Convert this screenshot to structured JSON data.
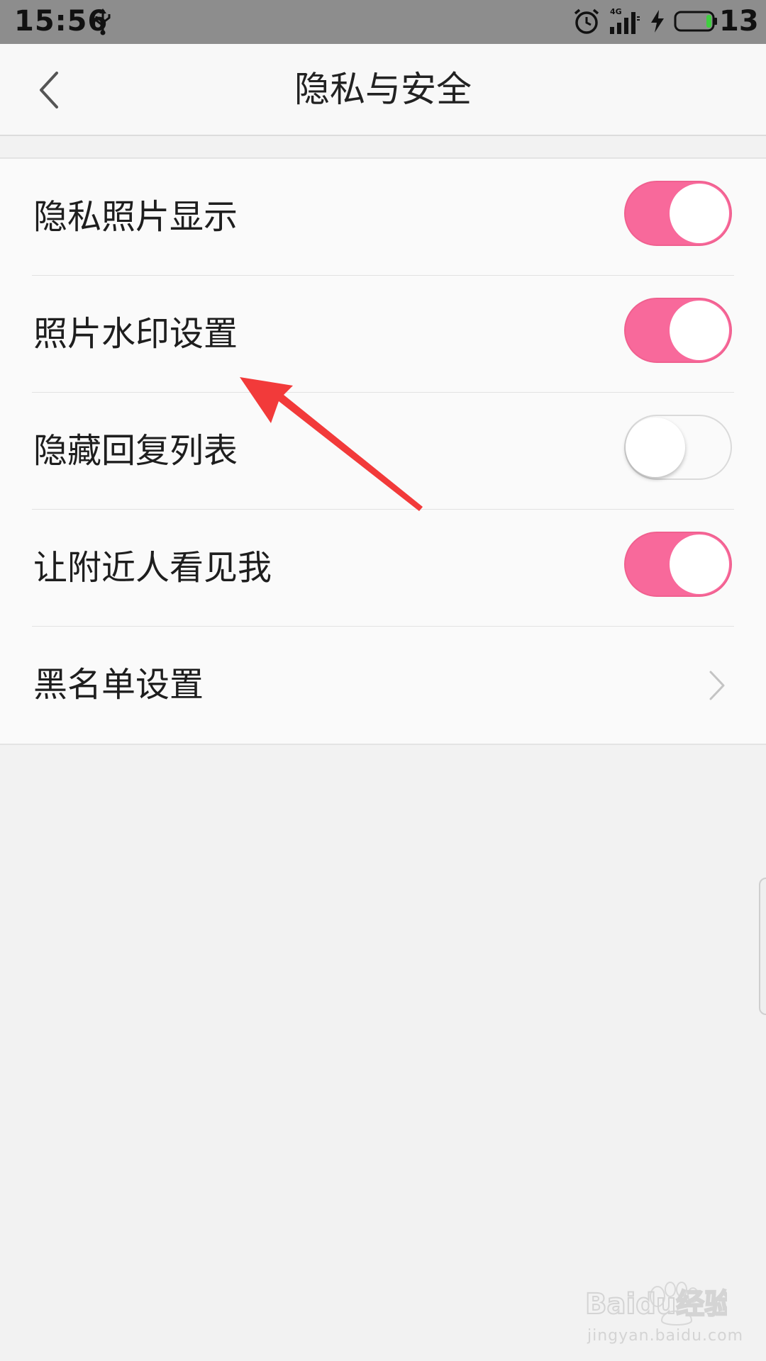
{
  "status_bar": {
    "time": "15:56",
    "network_type": "4G",
    "battery_level": "13",
    "icons": [
      "usb-icon",
      "alarm-clock-icon",
      "signal-icon",
      "charging-icon",
      "battery-icon"
    ]
  },
  "header": {
    "title": "隐私与安全",
    "back_icon": "chevron-left-icon"
  },
  "settings": {
    "items": [
      {
        "label": "隐私照片显示",
        "control": "toggle",
        "enabled": true
      },
      {
        "label": "照片水印设置",
        "control": "toggle",
        "enabled": true
      },
      {
        "label": "隐藏回复列表",
        "control": "toggle",
        "enabled": false
      },
      {
        "label": "让附近人看见我",
        "control": "toggle",
        "enabled": true
      },
      {
        "label": "黑名单设置",
        "control": "chevron",
        "icon": "chevron-right-icon"
      }
    ]
  },
  "colors": {
    "toggle_on": "#f8699b",
    "toggle_off": "#fafafa",
    "annotation_arrow": "#f23a3a",
    "status_bar": "#8d8d8d"
  },
  "watermark": {
    "logo_text": "Baidu经验",
    "url": "jingyan.baidu.com"
  }
}
